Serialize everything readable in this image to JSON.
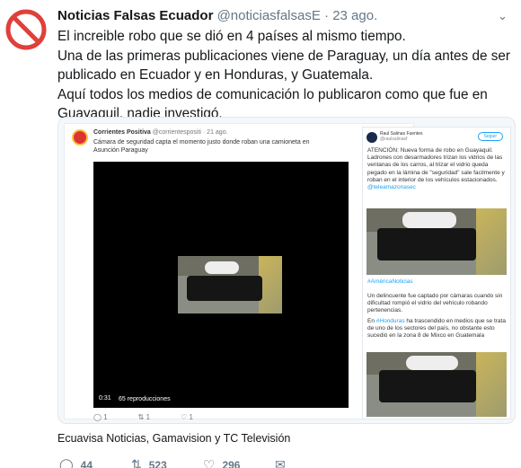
{
  "tweet": {
    "display_name": "Noticias Falsas Ecuador",
    "handle": "@noticiasfalsasE",
    "sep": "·",
    "date": "23 ago.",
    "lines": [
      "El increible robo que se dió en 4 países al mismo tiempo.",
      "Una de las primeras publicaciones viene de Paraguay, un día antes de ser",
      "publicado en Ecuador y en Honduras, y Guatemala.",
      "Aquí todos los medios de comunicación lo publicaron como que fue en",
      "Guayaquil, nadie investigó."
    ],
    "caption": "Ecuavisa Noticias, Gamavision y TC Televisión",
    "actions": {
      "replies": "44",
      "retweets": "523",
      "likes": "296"
    }
  },
  "embedded_left": {
    "name": "Corrientes Positiva",
    "handle": "@corrientespositi",
    "date": "· 21 ago.",
    "text_line1": "Cámara de seguridad capta el momento justo donde roban una camioneta en",
    "text_line2": "Asunción Paraguay",
    "video_time": "0:31",
    "video_views": "65 reproducciones",
    "replies": "1",
    "retweets": "1",
    "likes": "1"
  },
  "embedded_right": {
    "name": "Raul Salinas Fuentes",
    "handle": "@raulsalinasf",
    "follow_label": "Seguir",
    "text1": "ATENCIÓN: Nueva forma de robo en Guayaquil.",
    "text2": "Ladrones con desarmadores trizan los vidrios de las ventanas de los carros, al trizar el vidrio queda pegado en la lámina de \"seguridad\" sale facilmente y roban en el interior de los vehículos estacionados.",
    "mention": "@teleamazonasec",
    "hashtag1": "#AméricaNoticias",
    "text3": "Un delincuente fue captado por cámaras cuando sin dificultad rompió el vidrio del vehículo robando pertenencias.",
    "text4_pre": "En",
    "hashtag2": "#Honduras",
    "text4_post": "ha trascendido en medios que se trata de uno de los sectores del país, no obstante esto sucedió en la zona 8 de Mixco en Guatemala"
  },
  "colors": {
    "accent": "#1da1f2",
    "no_sign": "#e0403a",
    "muted": "#657786"
  }
}
